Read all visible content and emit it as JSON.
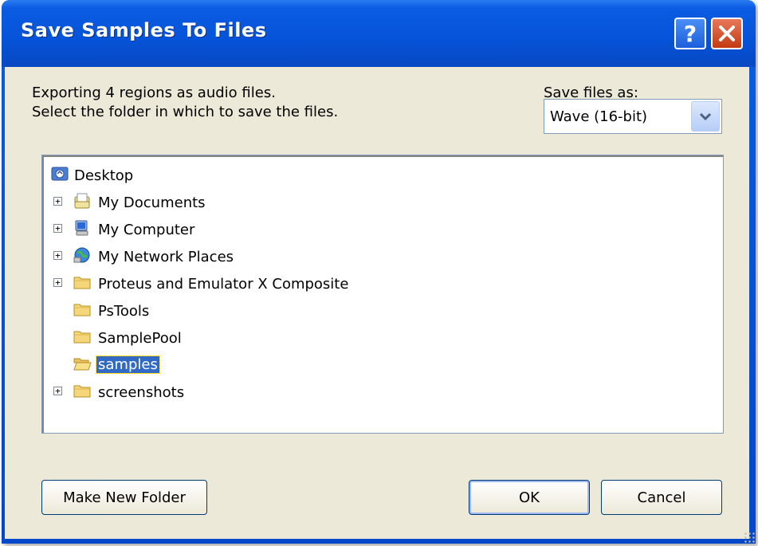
{
  "window": {
    "title": "Save Samples To Files"
  },
  "title_buttons": {
    "help": "?",
    "close": "✕"
  },
  "message": {
    "line1": "Exporting 4 regions as audio files.",
    "line2": "Select the folder in which to save the files."
  },
  "save_as": {
    "label": "Save files as:",
    "selected": "Wave (16-bit)"
  },
  "tree": {
    "items": [
      {
        "label": "Desktop",
        "icon": "desktop-icon",
        "expander": ""
      },
      {
        "label": "My Documents",
        "icon": "my-documents-icon",
        "expander": "+"
      },
      {
        "label": "My Computer",
        "icon": "my-computer-icon",
        "expander": "+"
      },
      {
        "label": "My Network Places",
        "icon": "network-places-icon",
        "expander": "+"
      },
      {
        "label": "Proteus and Emulator X Composite",
        "icon": "folder-icon",
        "expander": "+"
      },
      {
        "label": "PsTools",
        "icon": "folder-icon",
        "expander": ""
      },
      {
        "label": "SamplePool",
        "icon": "folder-icon",
        "expander": ""
      },
      {
        "label": "samples",
        "icon": "folder-open-icon",
        "expander": "",
        "selected": true
      },
      {
        "label": "screenshots",
        "icon": "folder-icon",
        "expander": "+"
      }
    ]
  },
  "buttons": {
    "make_new_folder": "Make New Folder",
    "ok": "OK",
    "cancel": "Cancel"
  },
  "colors": {
    "title_bar": "#0553d8",
    "dialog_face": "#ece9d8",
    "selection": "#316ac5"
  }
}
